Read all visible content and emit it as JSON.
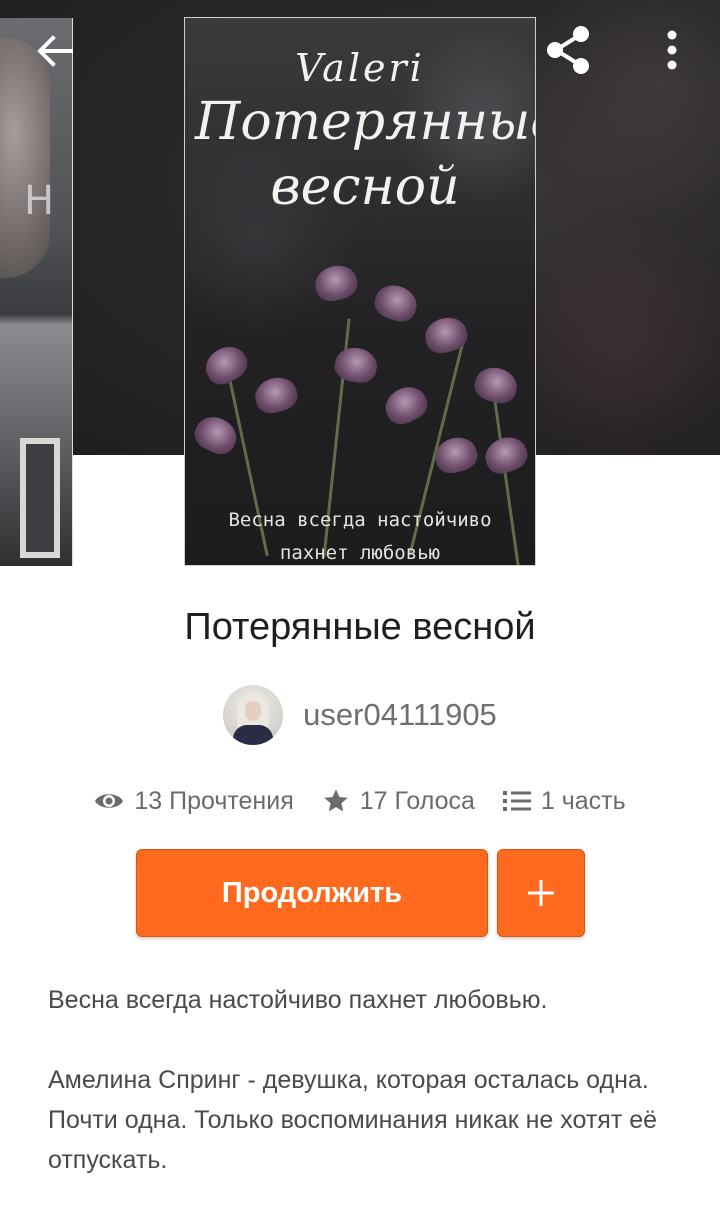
{
  "colors": {
    "accent": "#ff6a1f",
    "header_bg": "#2a2729",
    "text_primary": "#1f1f1f",
    "text_secondary": "#6b6b6b"
  },
  "toolbar": {
    "back_icon": "arrow-left-icon",
    "share_icon": "share-icon",
    "more_icon": "more-vertical-icon"
  },
  "cover": {
    "author": "Valeri",
    "title": "Потерянные весной",
    "tagline_line1": "Весна всегда настойчиво",
    "tagline_line2": "пахнет любовью"
  },
  "story": {
    "title": "Потерянные весной",
    "author": "user04111905",
    "stats": {
      "reads": "13 Прочтения",
      "votes": "17 Голоса",
      "parts": "1 часть"
    },
    "continue_label": "Продолжить",
    "add_icon": "plus-icon",
    "description": [
      "Весна всегда настойчиво пахнет любовью.",
      "Амелина Спринг - девушка, которая осталась одна. Почти одна. Только воспоминания никак не хотят её отпускать."
    ]
  }
}
